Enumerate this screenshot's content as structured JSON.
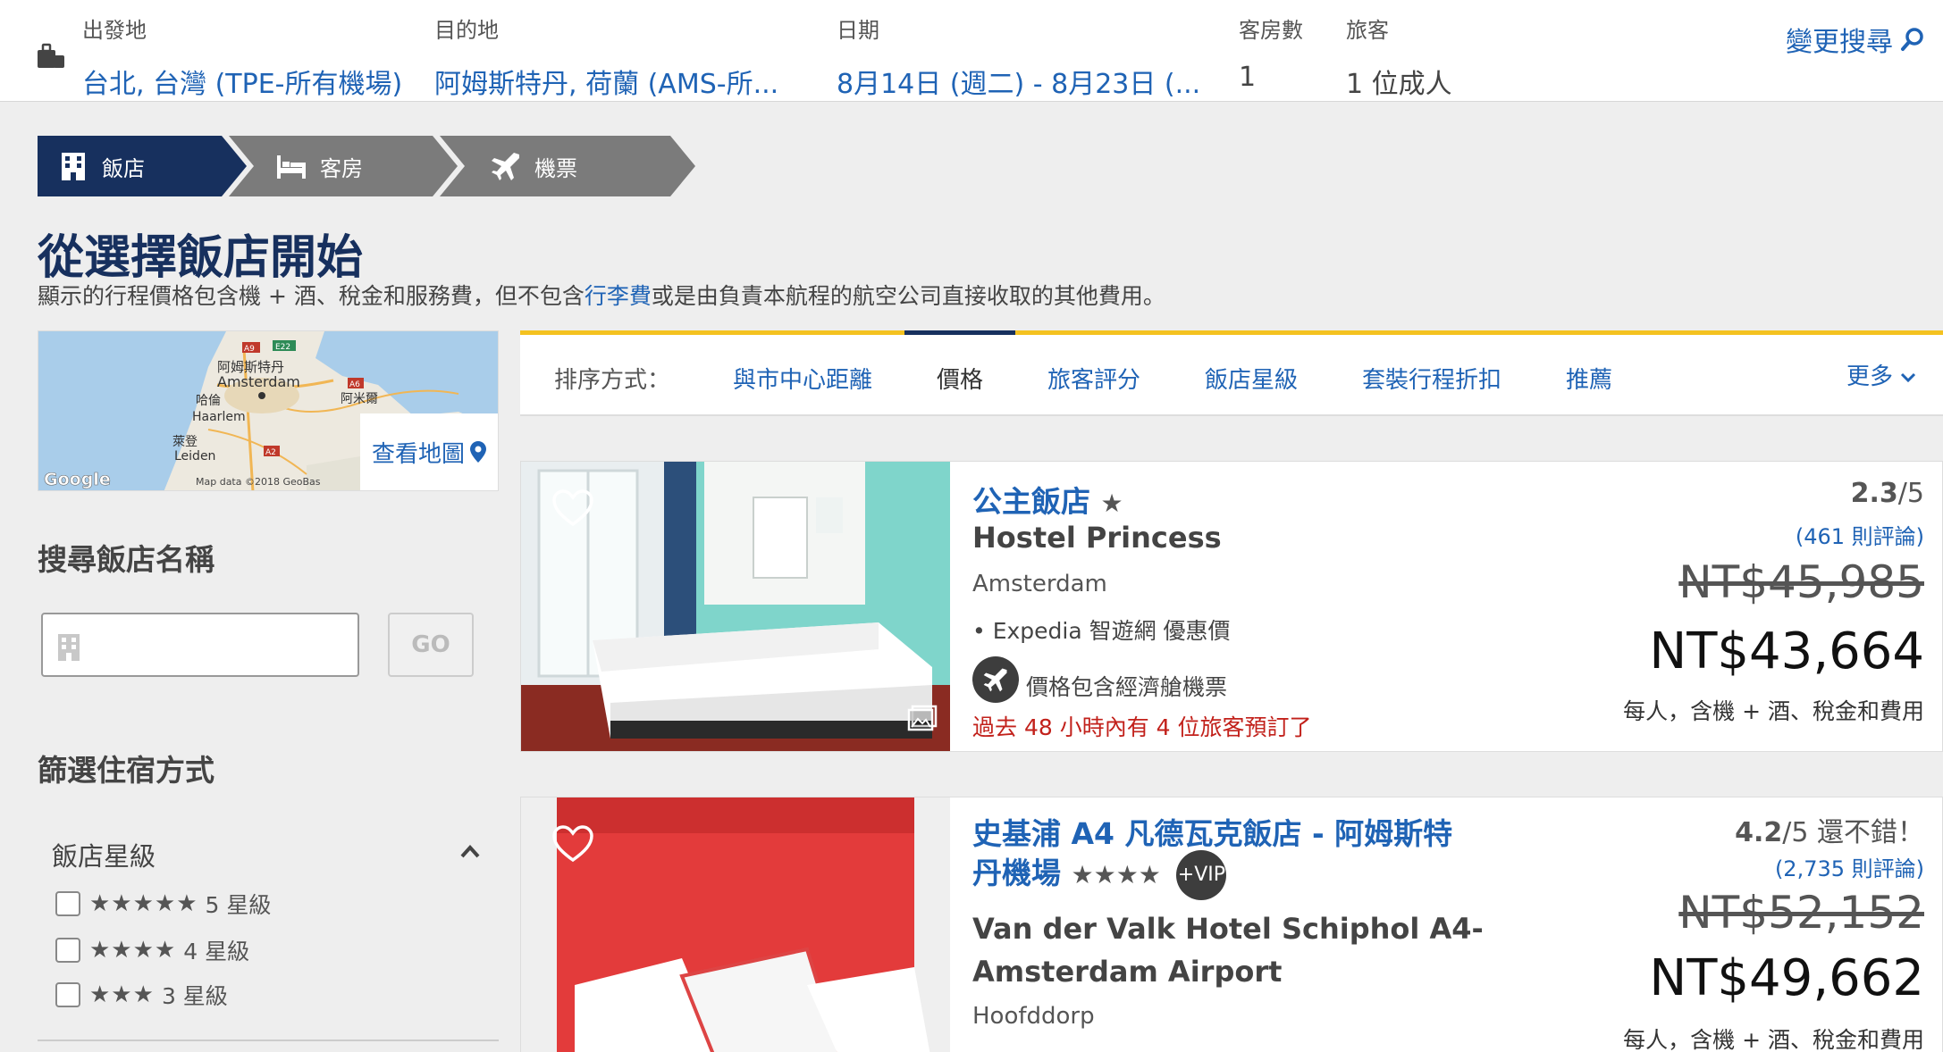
{
  "search": {
    "origin_label": "出發地",
    "origin_value": "台北, 台灣 (TPE-所有機場)",
    "destination_label": "目的地",
    "destination_value": "阿姆斯特丹, 荷蘭 (AMS-所...",
    "dates_label": "日期",
    "dates_value": "8月14日 (週二) - 8月23日 (...",
    "rooms_label": "客房數",
    "rooms_value": "1",
    "travelers_label": "旅客",
    "travelers_value": "1 位成人",
    "change_label": "變更搜尋"
  },
  "steps": [
    {
      "label": "飯店",
      "icon": "building-icon",
      "active": true
    },
    {
      "label": "客房",
      "icon": "bed-icon",
      "active": false
    },
    {
      "label": "機票",
      "icon": "plane-icon",
      "active": false
    }
  ],
  "page": {
    "title": "從選擇飯店開始",
    "disclaimer_before": "顯示的行程價格包含機 + 酒、稅金和服務費，但不包含",
    "disclaimer_link": "行李費",
    "disclaimer_after": "或是由負責本航程的航空公司直接收取的其他費用。"
  },
  "map": {
    "labels": {
      "a9": "A9",
      "e22": "E22",
      "a6": "A6",
      "a2": "A2",
      "amsterdam_zh": "阿姆斯特丹",
      "amsterdam": "Amsterdam",
      "almere_zh": "阿米爾",
      "haarlem_zh": "哈倫",
      "haarlem": "Haarlem",
      "leiden_zh": "萊登",
      "leiden": "Leiden",
      "google": "Google",
      "attribution": "Map data ©2018 GeoBas"
    },
    "view_map_label": "查看地圖"
  },
  "sidebar": {
    "search_heading": "搜尋飯店名稱",
    "search_placeholder": "",
    "go_label": "GO",
    "filter_heading": "篩選住宿方式",
    "star_group_title": "飯店星級",
    "star_options": [
      {
        "stars": "★★★★★",
        "label": "5 星級"
      },
      {
        "stars": "★★★★",
        "label": "4 星級"
      },
      {
        "stars": "★★★",
        "label": "3 星級"
      }
    ]
  },
  "sort": {
    "label": "排序方式：",
    "options": [
      "與市中心距離",
      "價格",
      "旅客評分",
      "飯店星級",
      "套裝行程折扣",
      "推薦"
    ],
    "active": "價格",
    "more_label": "更多"
  },
  "hotels": [
    {
      "name_local": "公主飯店",
      "stars": "★",
      "name_en": "Hostel Princess",
      "city": "Amsterdam",
      "deal": "• Expedia 智遊網 優惠價",
      "flight_note": "價格包含經濟艙機票",
      "urgency": "過去 48 小時內有 4 位旅客預訂了",
      "rating": "2.3",
      "rating_scale": "/5",
      "rating_word": "",
      "reviews": "(461 則評論)",
      "old_price": "NT$45,985",
      "new_price": "NT$43,664",
      "price_note": "每人，含機 + 酒、稅金和費用"
    },
    {
      "name_local_line1": "史基浦 A4 凡德瓦克飯店 - 阿姆斯特",
      "name_local_line2": "丹機場",
      "stars": "★★★★",
      "vip": "+VIP",
      "name_en_line1": "Van der Valk Hotel Schiphol A4-",
      "name_en_line2": "Amsterdam Airport",
      "city": "Hoofddorp",
      "rating": "4.2",
      "rating_scale": "/5",
      "rating_word": "還不錯！",
      "reviews": "(2,735 則評論)",
      "old_price": "NT$52,152",
      "new_price": "NT$49,662",
      "price_note": "每人，含機 + 酒、稅金和費用"
    }
  ],
  "colors": {
    "link_blue": "#1f63b5",
    "navy": "#17305e",
    "step_gray": "#7b7b7b",
    "accent_yellow": "#f4c220",
    "alert_red": "#c2211b"
  }
}
